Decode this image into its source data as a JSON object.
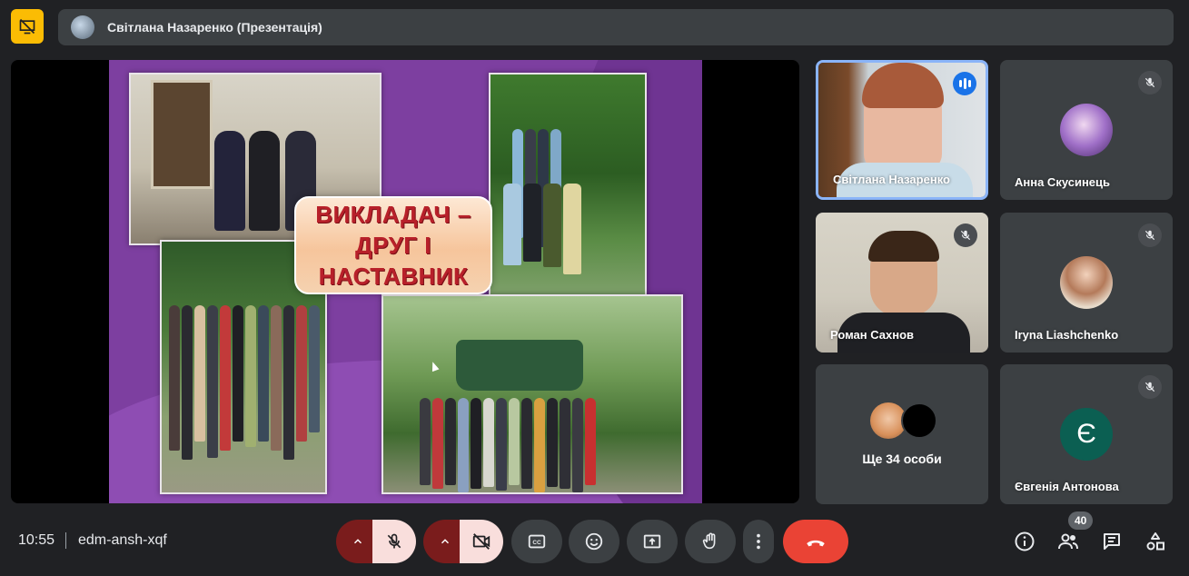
{
  "top_bar": {
    "present_toggle_icon": "presentation-off-icon",
    "presenter_label": "Світлана Назаренко (Презентація)"
  },
  "slide": {
    "title_lines": [
      "ВИКЛАДАЧ –",
      "ДРУГ І",
      "НАСТАВНИК"
    ]
  },
  "participants": [
    {
      "name": "Світлана Назаренко",
      "state": "speaking"
    },
    {
      "name": "Анна Скусинець",
      "state": "muted"
    },
    {
      "name": "Роман Сахнов",
      "state": "muted"
    },
    {
      "name": "Iryna Liashchenko",
      "state": "muted"
    },
    {
      "name": "Ще 34 особи",
      "state": "overflow"
    },
    {
      "name": "Євгенія Антонова",
      "state": "muted",
      "initial": "Є"
    }
  ],
  "bottom_bar": {
    "time": "10:55",
    "meeting_code": "edm-ansh-xqf",
    "participant_count": "40"
  },
  "colors": {
    "accent_yellow": "#fbbc04",
    "end_call_red": "#ea4335",
    "speaking_blue": "#1a73e8",
    "active_border": "#8ab4f8"
  }
}
